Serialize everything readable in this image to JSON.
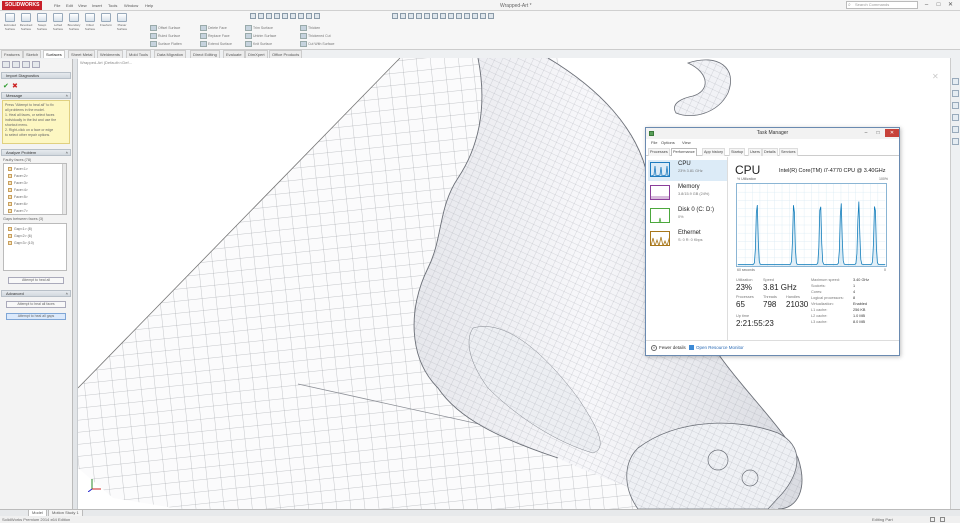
{
  "app": {
    "logo": "SOLIDWORKS",
    "menu": [
      "File",
      "Edit",
      "View",
      "Insert",
      "Tools",
      "Window",
      "Help"
    ],
    "doc_title": "Wrapped-Art *",
    "search_placeholder": "Search Commands",
    "controls": {
      "minimize": "–",
      "maximize": "□",
      "close": "✕"
    }
  },
  "ribbon": {
    "large_buttons": [
      "Extruded Surface",
      "Revolved Surface",
      "Swept Surface",
      "Lofted Surface",
      "Boundary Surface",
      "Filled Surface",
      "Freeform",
      "Planar Surface"
    ],
    "small_buttons": [
      "Offset Surface",
      "Ruled Surface",
      "Surface Flatten",
      "Delete Face",
      "Replace Face",
      "Extend Surface",
      "Trim Surface",
      "Untrim Surface",
      "Knit Surface",
      "Thicken",
      "Thickened Cut",
      "Cut With Surface"
    ]
  },
  "command_tabs": [
    "Features",
    "Sketch",
    "Surfaces",
    "Sheet Metal",
    "Weldments",
    "Mold Tools",
    "Data Migration",
    "Direct Editing",
    "Evaluate",
    "DimXpert",
    "Office Products"
  ],
  "property_manager": {
    "title": "Import Diagnostics",
    "message_header": "Message",
    "message_lines": [
      "Press \"Attempt to heal all\" to fix",
      "all problems in the model.",
      "1. Heal all faces, or select faces",
      "individually in the list and use the",
      "shortcut menu.",
      "2. Right-click on a face or edge",
      "to select other repair options."
    ],
    "analyze_header": "Analyze Problem",
    "faulty_faces_label": "Faulty faces (78)",
    "faces": [
      "Face<1>",
      "Face<2>",
      "Face<3>",
      "Face<4>",
      "Face<5>",
      "Face<6>",
      "Face<7>"
    ],
    "gaps_label": "Gaps between faces (3)",
    "gaps": [
      "Gap<1> (8)",
      "Gap<2> (6)",
      "Gap<3> (10)"
    ],
    "attempt_faces_btn": "Attempt to heal all",
    "advanced_header": "Advanced",
    "advanced_btn_1": "Attempt to heal all faces",
    "advanced_btn_2": "Attempt to heal all gaps"
  },
  "viewport": {
    "tree_label": "Wrapped-Art (Default<<Def..."
  },
  "bottom_tabs": [
    "Model",
    "Motion Study 1"
  ],
  "status": {
    "left": "SolidWorks Premium 2014 x64 Edition",
    "right": "Editing Part"
  },
  "task_manager": {
    "title": "Task Manager",
    "menu": [
      "File",
      "Options",
      "View"
    ],
    "tabs": [
      "Processes",
      "Performance",
      "App history",
      "Startup",
      "Users",
      "Details",
      "Services"
    ],
    "active_tab": "Performance",
    "resources": [
      {
        "name": "CPU",
        "value": "23% 3.81 GHz",
        "color": "#1d7bbf"
      },
      {
        "name": "Memory",
        "value": "3.8/15.9 GB (24%)",
        "color": "#8b3f9a"
      },
      {
        "name": "Disk 0 (C: D:)",
        "value": "0%",
        "color": "#4ca83d"
      },
      {
        "name": "Ethernet",
        "value": "S: 0 R: 0 Kbps",
        "color": "#a8771b"
      }
    ],
    "cpu_title": "CPU",
    "cpu_model": "Intel(R) Core(TM) i7-4770 CPU @ 3.40GHz",
    "util_label": "% Utilization",
    "max_label": "100%",
    "time_label": "60 seconds",
    "zero_label": "0",
    "stats": [
      {
        "label": "Utilization",
        "value": "23%"
      },
      {
        "label": "Speed",
        "value": "3.81 GHz"
      },
      {
        "label": "Processes",
        "value": "65"
      },
      {
        "label": "Threads",
        "value": "798"
      },
      {
        "label": "Handles",
        "value": "21030"
      },
      {
        "label": "Up time",
        "value": "2:21:55:23"
      }
    ],
    "specs": [
      {
        "k": "Maximum speed:",
        "v": "3.40 GHz"
      },
      {
        "k": "Sockets:",
        "v": "1"
      },
      {
        "k": "Cores:",
        "v": "4"
      },
      {
        "k": "Logical processors:",
        "v": "8"
      },
      {
        "k": "Virtualization:",
        "v": "Enabled"
      },
      {
        "k": "L1 cache:",
        "v": "256 KB"
      },
      {
        "k": "L2 cache:",
        "v": "1.0 MB"
      },
      {
        "k": "L3 cache:",
        "v": "8.0 MB"
      }
    ],
    "fewer_details": "Fewer details",
    "open_monitor": "Open Resource Monitor",
    "graph_line_color": "#117dbb",
    "graph_grid_color": "#d9eaf4"
  }
}
